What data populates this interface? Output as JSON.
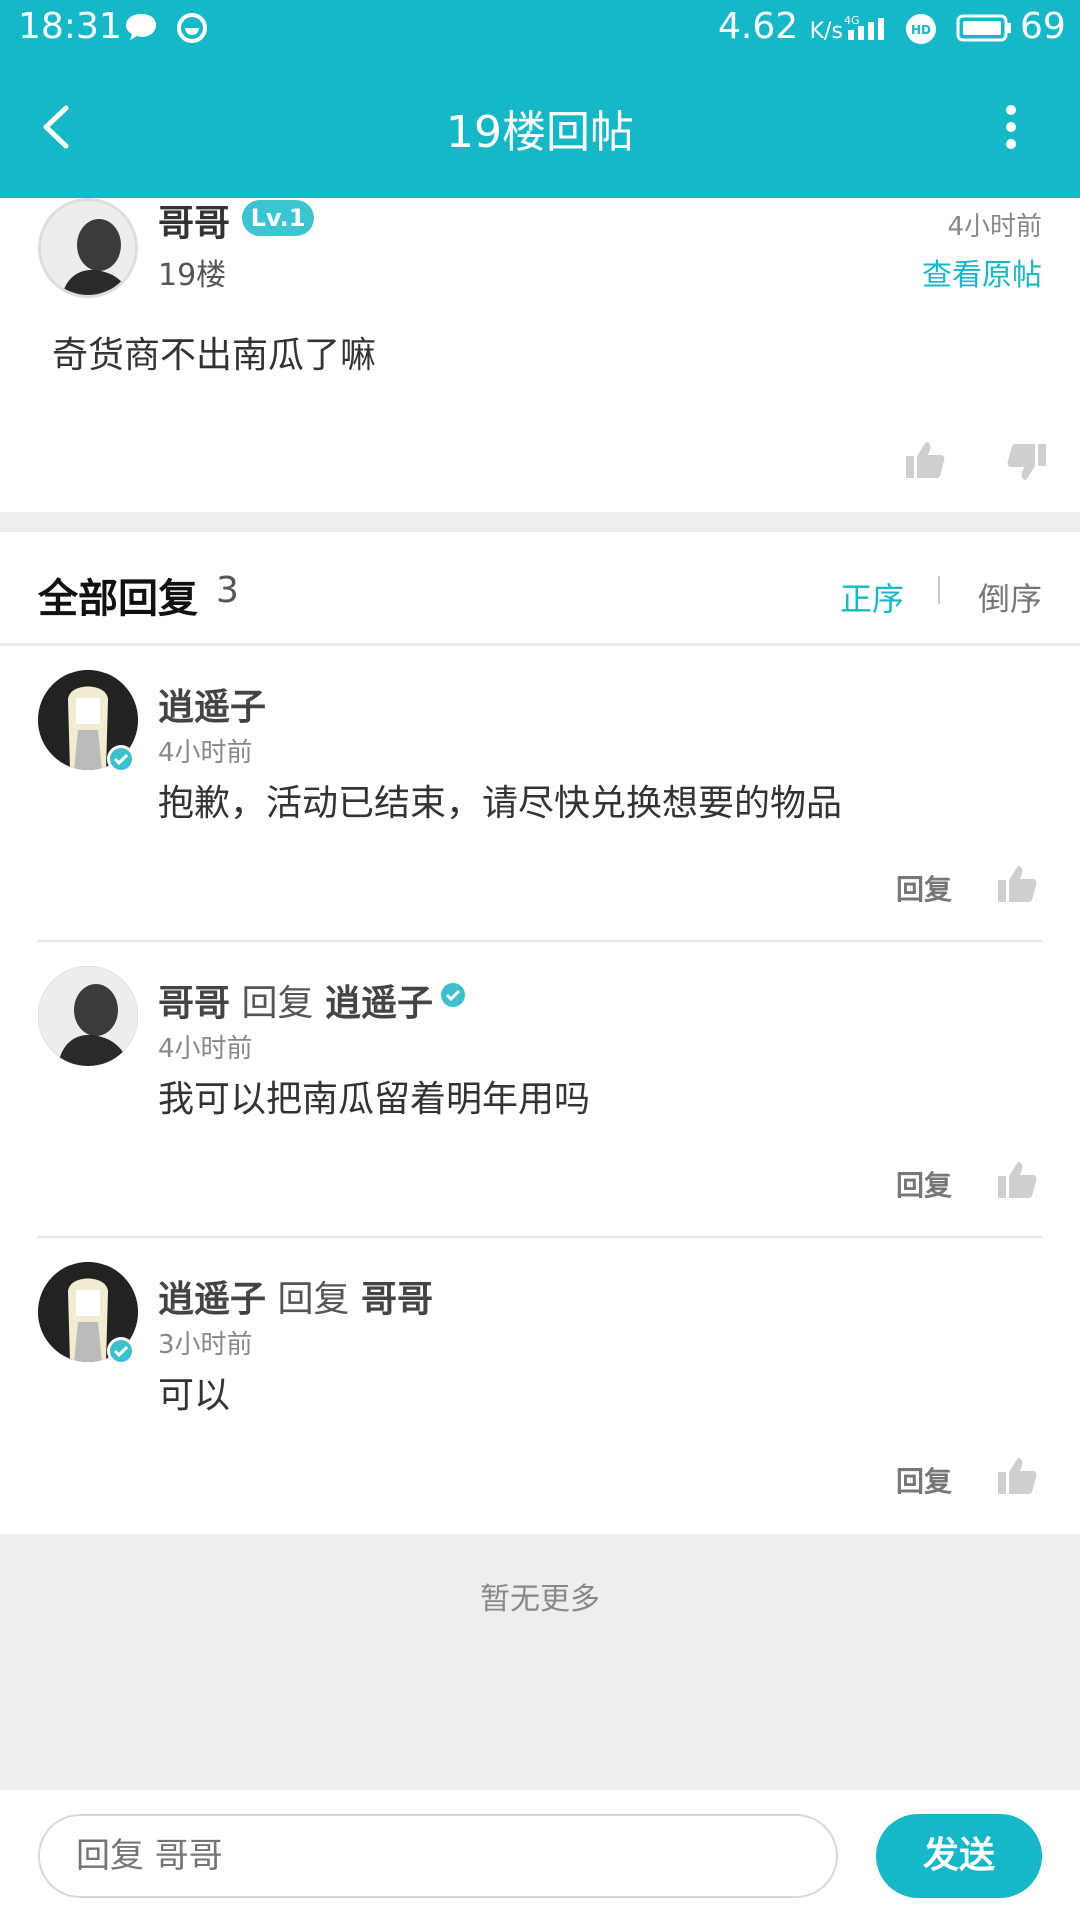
{
  "status_bar": {
    "time": "18:31",
    "speed": "4.62",
    "speed_unit": "K/s",
    "battery": "69"
  },
  "header": {
    "title": "19楼回帖"
  },
  "post": {
    "author": "哥哥",
    "level": "Lv.1",
    "floor": "19楼",
    "time": "4小时前",
    "view_original": "查看原帖",
    "content": "奇货商不出南瓜了嘛"
  },
  "replies_header": {
    "title": "全部回复",
    "count": "3",
    "sort_asc": "正序",
    "sort_desc": "倒序"
  },
  "comments": [
    {
      "author": "逍遥子",
      "reply_word": "",
      "target": "",
      "time": "4小时前",
      "text": "抱歉，活动已结束，请尽快兑换想要的物品",
      "reply_label": "回复"
    },
    {
      "author": "哥哥",
      "reply_word": "回复",
      "target": "逍遥子",
      "time": "4小时前",
      "text": "我可以把南瓜留着明年用吗",
      "reply_label": "回复"
    },
    {
      "author": "逍遥子",
      "reply_word": "回复",
      "target": "哥哥",
      "time": "3小时前",
      "text": "可以",
      "reply_label": "回复"
    }
  ],
  "no_more": "暂无更多",
  "composer": {
    "placeholder": "回复 哥哥",
    "send": "发送"
  },
  "colors": {
    "accent": "#16b8c7",
    "background_gray": "#eeeeee"
  }
}
